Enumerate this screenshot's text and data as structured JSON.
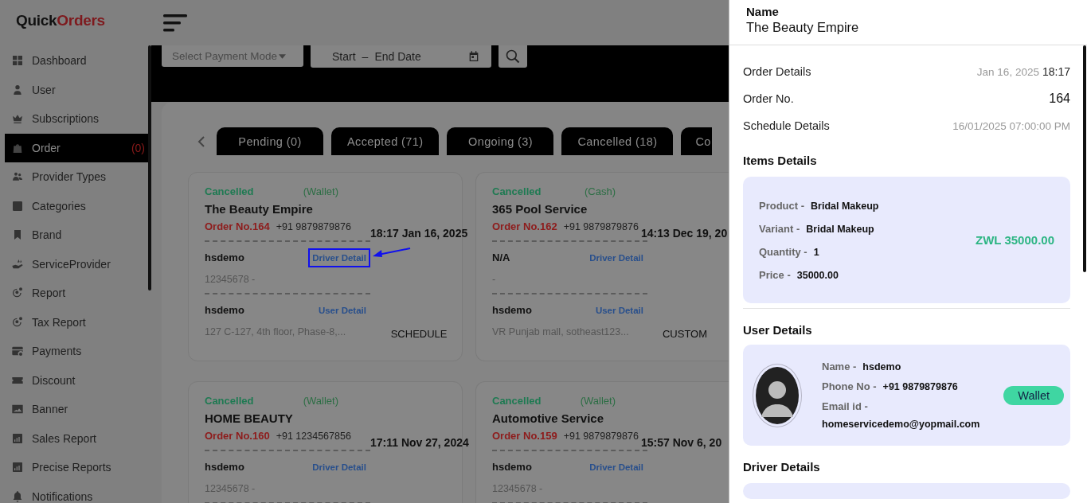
{
  "brand": {
    "logo": "Quick",
    "logo_accent": "Orders"
  },
  "sidebar": {
    "items": [
      {
        "label": "Dashboard",
        "selected": false
      },
      {
        "label": "User",
        "selected": false
      },
      {
        "label": "Subscriptions",
        "selected": false
      },
      {
        "label": "Order",
        "selected": true,
        "badge": "(0)"
      },
      {
        "label": "Provider Types",
        "selected": false
      },
      {
        "label": "Categories",
        "selected": false
      },
      {
        "label": "Brand",
        "selected": false
      },
      {
        "label": "ServiceProvider",
        "selected": false
      },
      {
        "label": "Report",
        "selected": false
      },
      {
        "label": "Tax Report",
        "selected": false
      },
      {
        "label": "Payments",
        "selected": false
      },
      {
        "label": "Discount",
        "selected": false
      },
      {
        "label": "Banner",
        "selected": false
      },
      {
        "label": "Sales Report",
        "selected": false
      },
      {
        "label": "Precise Reports",
        "selected": false
      },
      {
        "label": "Notifications",
        "selected": false
      }
    ]
  },
  "filters": {
    "payment_mode": {
      "placeholder": "Select Payment Mode"
    },
    "date_range": {
      "start": "Start",
      "separator": "–",
      "end": "End Date"
    }
  },
  "tabs": [
    {
      "label": "Pending (0)",
      "selected": false
    },
    {
      "label": "Accepted (71)",
      "selected": false
    },
    {
      "label": "Ongoing (3)",
      "selected": false
    },
    {
      "label": "Cancelled (18)",
      "selected": false
    },
    {
      "label": "Co",
      "selected": false
    }
  ],
  "orders": [
    {
      "status": "Cancelled",
      "payment": "(Wallet)",
      "name": "The Beauty Empire",
      "order_no": "Order No.164",
      "phone": "+91 9879879876",
      "time": "18:17 Jan 16, 2025",
      "driver": {
        "name": "hsdemo",
        "phone": "12345678 -",
        "link": "Driver Detail",
        "highlighted": true
      },
      "user": {
        "name": "hsdemo",
        "address": "127 C-127, 4th floor, Phase-8,...",
        "link": "User Detail"
      },
      "type": "SCHEDULE"
    },
    {
      "status": "Cancelled",
      "payment": "(Cash)",
      "name": "365 Pool Service",
      "order_no": "Order No.162",
      "phone": "+91 9879879876",
      "time": "14:13 Dec 19, 20",
      "driver": {
        "name": "N/A",
        "phone": "-",
        "link": "Driver Detail",
        "highlighted": false
      },
      "user": {
        "name": "hsdemo",
        "address": "VR Punjab mall, sotheast123...",
        "link": "User Detail"
      },
      "type": "CUSTOM"
    },
    {
      "status": "Cancelled",
      "payment": "(Wallet)",
      "name": "HOME BEAUTY",
      "order_no": "Order No.160",
      "phone": "+91 1234567856",
      "time": "17:11 Nov 27, 2024",
      "driver": {
        "name": "hsdemo",
        "phone": "12345678 -",
        "link": "Driver Detail",
        "highlighted": false
      }
    },
    {
      "status": "Cancelled",
      "payment": "(Wallet)",
      "name": "Automotive Service",
      "order_no": "Order No.159",
      "phone": "+91 9879879876",
      "time": "15:57 Nov 6, 20",
      "driver": {
        "name": "hsdemo",
        "phone": "12345678 -",
        "link": "Driver Detail",
        "highlighted": false
      }
    }
  ],
  "drawer": {
    "header": {
      "label": "Name",
      "value": "The Beauty Empire"
    },
    "summary": [
      {
        "kind": "datetime",
        "label": "Order Details",
        "date": "Jan 16, 2025",
        "time": "18:17"
      },
      {
        "kind": "number",
        "label": "Order No.",
        "value": "164"
      },
      {
        "kind": "muted",
        "label": "Schedule Details",
        "value": "16/01/2025 07:00:00 PM"
      }
    ],
    "items": {
      "title": "Items Details",
      "fields": [
        {
          "label": "Product -",
          "value": "Bridal Makeup"
        },
        {
          "label": "Variant -",
          "value": "Bridal Makeup"
        },
        {
          "label": "Quantity -",
          "value": "1"
        },
        {
          "label": "Price -",
          "value": "35000.00"
        }
      ],
      "amount": "ZWL 35000.00"
    },
    "user": {
      "title": "User Details",
      "fields": [
        {
          "label": "Name -",
          "value": "hsdemo"
        },
        {
          "label": "Phone No -",
          "value": "+91 9879879876"
        },
        {
          "label": "Email id -",
          "value": "homeservicedemo@yopmail.com"
        }
      ],
      "payment": "Wallet"
    },
    "driver": {
      "title": "Driver Details"
    }
  }
}
